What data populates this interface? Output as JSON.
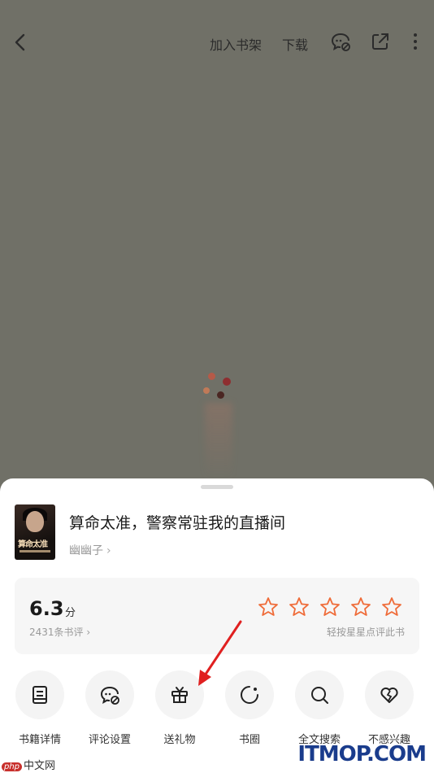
{
  "topbar": {
    "add_shelf_label": "加入书架",
    "download_label": "下载",
    "icons": [
      "back-icon",
      "comment-setting-icon",
      "share-icon",
      "more-icon"
    ]
  },
  "book": {
    "title": "算命太准，警察常驻我的直播间",
    "author": "幽幽子",
    "author_chevron": "›",
    "cover_text": "算命太准"
  },
  "rating": {
    "score": "6.3",
    "score_unit": "分",
    "review_count": "2431条书评 ›",
    "hint": "轻按星星点评此书",
    "star_count": 5,
    "star_color": "#ef6b38"
  },
  "actions": [
    {
      "label": "书籍详情",
      "icon": "book-detail-icon"
    },
    {
      "label": "评论设置",
      "icon": "comment-setting-icon"
    },
    {
      "label": "送礼物",
      "icon": "gift-icon"
    },
    {
      "label": "书圈",
      "icon": "circle-icon"
    },
    {
      "label": "全文搜索",
      "icon": "search-icon"
    },
    {
      "label": "不感兴趣",
      "icon": "not-interested-icon"
    }
  ],
  "watermark": {
    "left_badge": "php",
    "left_text": "中文网",
    "right_text": "ITMOP.COM"
  },
  "colors": {
    "overlay": "#707067",
    "annotation_arrow": "#e02020"
  }
}
